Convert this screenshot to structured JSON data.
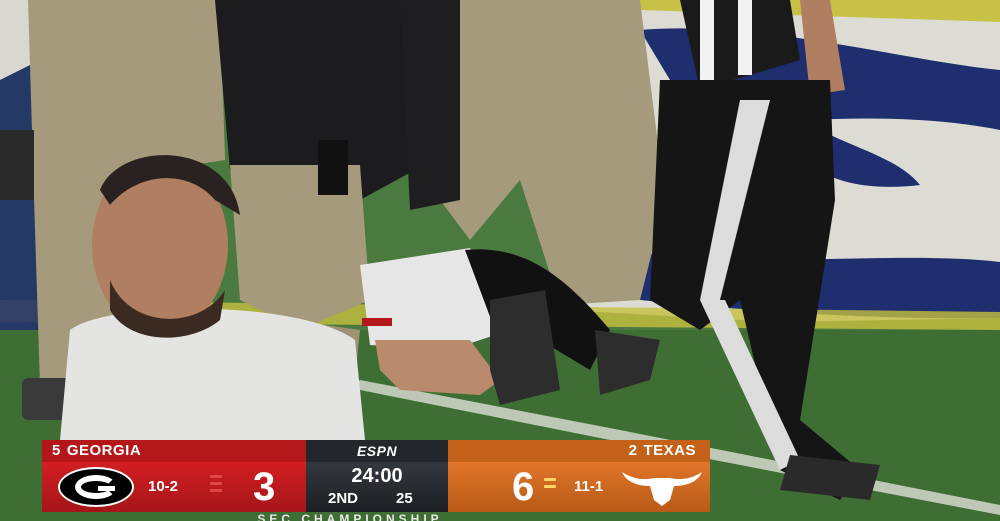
{
  "scorebug": {
    "network": "ESPN",
    "home": {
      "rank": "5",
      "name": "GEORGIA",
      "record": "10-2",
      "score": "3",
      "color": "#b3171a",
      "logo": "georgia-g-logo"
    },
    "away": {
      "rank": "2",
      "name": "TEXAS",
      "record": "11-1",
      "score": "6",
      "color": "#c4621a",
      "logo": "longhorn-logo"
    },
    "clock": "24:00",
    "quarter": "2ND",
    "play_clock": "25",
    "event": "SEC CHAMPIONSHIP"
  }
}
